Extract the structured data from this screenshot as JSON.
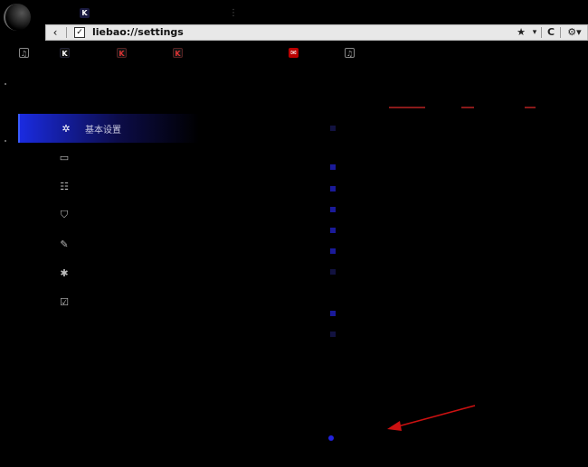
{
  "browser": {
    "tabs": [
      {
        "icon": "K",
        "label": ""
      },
      {
        "icon": "",
        "label": "⋮"
      }
    ],
    "url": "liebao://settings",
    "toolbar": {
      "back": "‹",
      "star": "★",
      "dropdown": "▾",
      "refresh": "C",
      "menu": "⚙▾"
    }
  },
  "bookmarks": [
    {
      "icon": "♫",
      "style": "gray"
    },
    {
      "icon": "K",
      "style": "kb"
    },
    {
      "icon": "K",
      "style": "k"
    },
    {
      "icon": "K",
      "style": "k"
    },
    {
      "icon": "✉",
      "style": "red"
    },
    {
      "icon": "♫",
      "style": "gray"
    }
  ],
  "sidebar": {
    "items": [
      {
        "icon": "gear-icon",
        "glyph": "✲",
        "label": "基本设置",
        "active": true
      },
      {
        "icon": "laptop-icon",
        "glyph": "▭",
        "label": "",
        "active": false
      },
      {
        "icon": "grid-icon",
        "glyph": "☷",
        "label": "",
        "active": false
      },
      {
        "icon": "shield-icon",
        "glyph": "⛉",
        "label": "",
        "active": false
      },
      {
        "icon": "wrench-icon",
        "glyph": "✎",
        "label": "",
        "active": false
      },
      {
        "icon": "puzzle-icon",
        "glyph": "✱",
        "label": "",
        "active": false
      },
      {
        "icon": "check-icon",
        "glyph": "☑",
        "label": "",
        "active": false
      }
    ]
  },
  "content": {
    "sections": [
      {
        "label": "",
        "rows": []
      },
      {
        "label": "",
        "rows": []
      },
      {
        "label": "",
        "rows": []
      },
      {
        "label": "",
        "rows": []
      },
      {
        "label": "",
        "rows": []
      }
    ]
  },
  "colors": {
    "accent": "#1a2be0",
    "annotation": "#cc1111"
  }
}
